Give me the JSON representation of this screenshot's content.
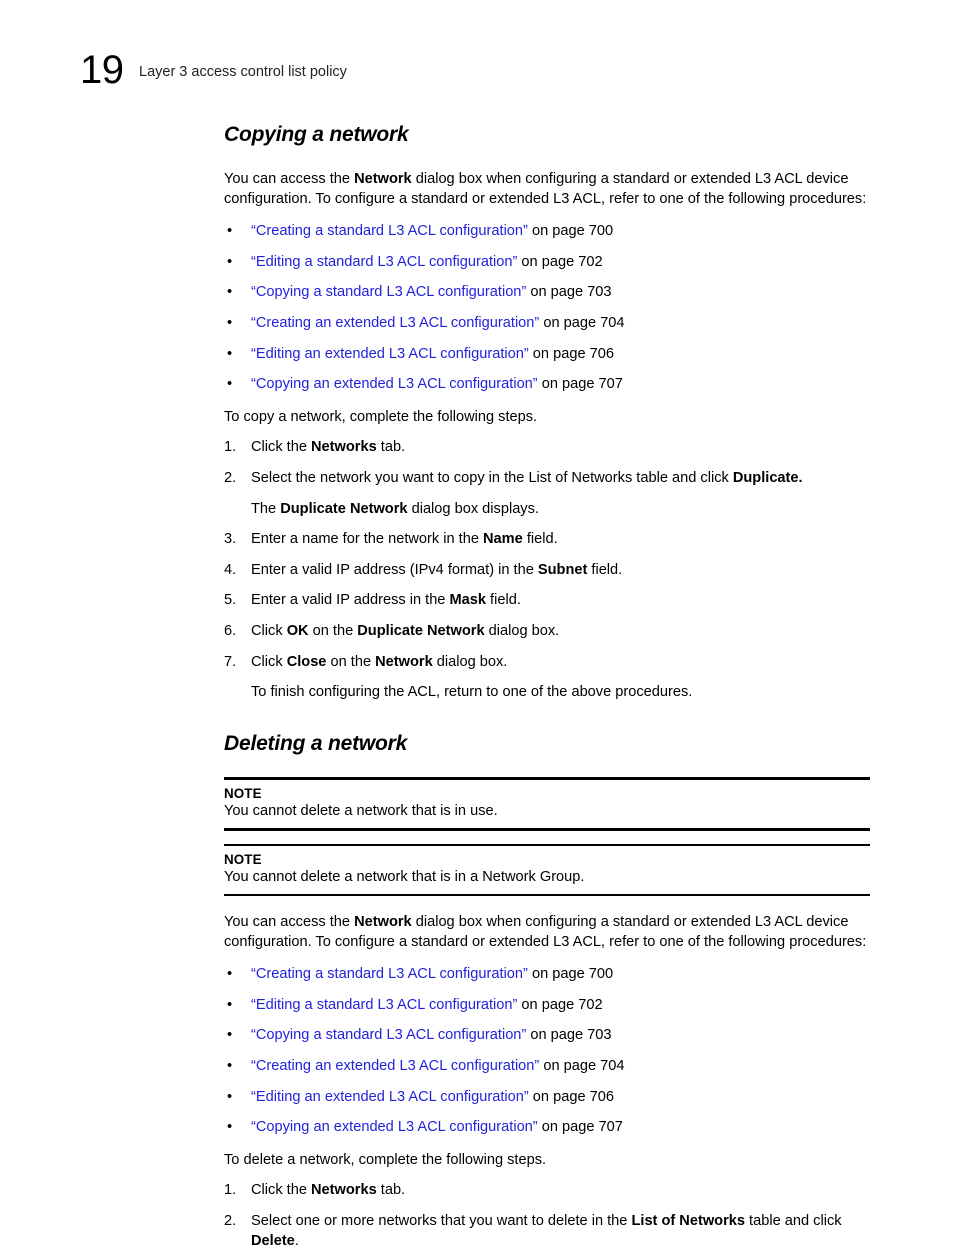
{
  "runhead": {
    "chapter_number": "19",
    "title": "Layer 3 access control list policy"
  },
  "sections": [
    {
      "heading": "Copying a network",
      "intro": {
        "pre": "You can access the ",
        "bold1": "Network",
        "post": " dialog box when configuring a standard or extended L3 ACL device configuration. To configure a standard or extended L3 ACL, refer to one of the following procedures:"
      },
      "links": [
        {
          "title": "“Creating a standard L3 ACL configuration”",
          "suffix": " on page 700"
        },
        {
          "title": "“Editing a standard L3 ACL configuration”",
          "suffix": " on page 702"
        },
        {
          "title": "“Copying a standard L3 ACL configuration”",
          "suffix": " on page 703"
        },
        {
          "title": "“Creating an extended L3 ACL configuration”",
          "suffix": " on page 704"
        },
        {
          "title": "“Editing an extended L3 ACL configuration”",
          "suffix": " on page 706"
        },
        {
          "title": "“Copying an extended L3 ACL configuration”",
          "suffix": " on page 707"
        }
      ],
      "lead_in": "To copy a network, complete the following steps.",
      "steps": [
        {
          "num": "1.",
          "a": "Click the ",
          "b": "Networks",
          "c": " tab."
        },
        {
          "num": "2.",
          "a": "Select the network you want to copy in the List of Networks table and click ",
          "b": "Duplicate.",
          "c": ""
        },
        {
          "num": "3.",
          "a": "Enter a name for the network in the ",
          "b": "Name",
          "c": " field."
        },
        {
          "num": "4.",
          "a": "Enter a valid IP address (IPv4 format) in the ",
          "b": "Subnet",
          "c": " field."
        },
        {
          "num": "5.",
          "a": "Enter a valid IP address in the ",
          "b": "Mask",
          "c": " field."
        },
        {
          "num": "6.",
          "a": "Click ",
          "b": "OK",
          "c": " on the ",
          "d": "Duplicate Network",
          "e": " dialog box."
        },
        {
          "num": "7.",
          "a": "Click ",
          "b": "Close",
          "c": " on the ",
          "d": "Network",
          "e": " dialog box."
        }
      ],
      "substep_after_2": {
        "a": "The ",
        "b": "Duplicate Network",
        "c": " dialog box displays."
      },
      "closing": "To finish configuring the ACL, return to one of the above procedures."
    },
    {
      "heading": "Deleting a network",
      "notes": [
        {
          "label": "NOTE",
          "text": "You cannot delete a network that is in use."
        },
        {
          "label": "NOTE",
          "text": "You cannot delete a network that is in a Network Group."
        }
      ],
      "intro": {
        "pre": "You can access the ",
        "bold1": "Network",
        "post": " dialog box when configuring a standard or extended L3 ACL device configuration. To configure a standard or extended L3 ACL, refer to one of the following procedures:"
      },
      "links": [
        {
          "title": "“Creating a standard L3 ACL configuration”",
          "suffix": " on page 700"
        },
        {
          "title": "“Editing a standard L3 ACL configuration”",
          "suffix": " on page 702"
        },
        {
          "title": "“Copying a standard L3 ACL configuration”",
          "suffix": " on page 703"
        },
        {
          "title": "“Creating an extended L3 ACL configuration”",
          "suffix": " on page 704"
        },
        {
          "title": "“Editing an extended L3 ACL configuration”",
          "suffix": " on page 706"
        },
        {
          "title": "“Copying an extended L3 ACL configuration”",
          "suffix": " on page 707"
        }
      ],
      "lead_in": "To delete a network, complete the following steps.",
      "steps": [
        {
          "num": "1.",
          "a": "Click the ",
          "b": "Networks",
          "c": " tab."
        },
        {
          "num": "2.",
          "a": "Select one or more networks that you want to delete in the ",
          "b": "List of Networks",
          "c": " table and click ",
          "d": "Delete",
          "e": "."
        }
      ]
    }
  ],
  "bullet_glyph": "•",
  "colors": {
    "link": "#2222dd",
    "text": "#000000",
    "page_background": "#ffffff"
  }
}
